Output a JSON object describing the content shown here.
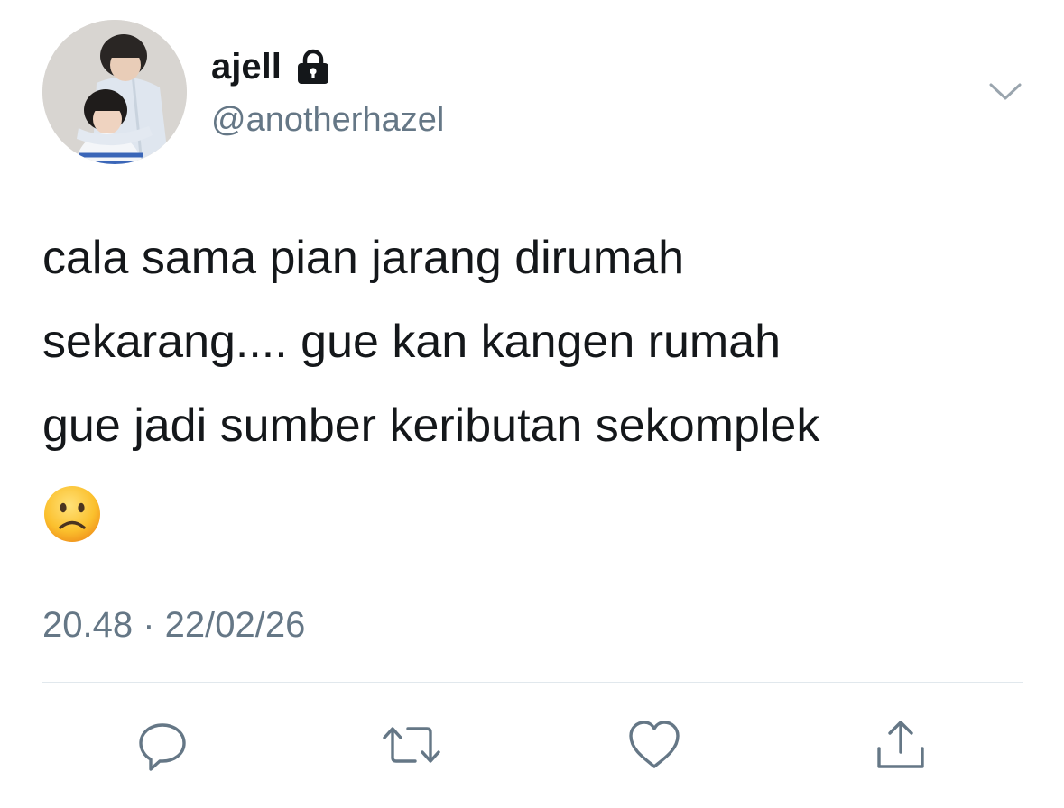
{
  "user": {
    "display_name": "ajell",
    "handle": "@anotherhazel",
    "protected_icon": "lock-icon",
    "avatar": "profile-photo"
  },
  "tweet": {
    "lines": [
      "cala sama pian jarang dirumah",
      "sekarang.... gue kan kangen rumah",
      "gue jadi sumber keributan sekomplek"
    ],
    "emoji": "frowning-face-emoji",
    "timestamp": "20.48 · 22/02/26"
  },
  "menu": {
    "icon": "chevron-down-icon"
  },
  "actions": [
    {
      "name": "reply",
      "icon": "reply-icon"
    },
    {
      "name": "retweet",
      "icon": "retweet-icon"
    },
    {
      "name": "like",
      "icon": "heart-icon"
    },
    {
      "name": "share",
      "icon": "share-icon"
    }
  ],
  "colors": {
    "text_primary": "#14171a",
    "text_secondary": "#657786",
    "divider": "#e1e8ed",
    "icon": "#657786"
  }
}
